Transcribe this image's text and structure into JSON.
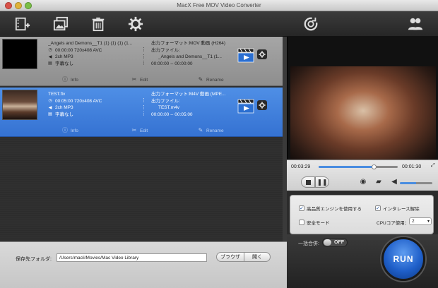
{
  "window": {
    "title": "MacX Free MOV Video Converter"
  },
  "toolbar": {
    "add_video": "add-video-icon",
    "add_photo": "add-photo-icon",
    "delete": "trash-icon",
    "settings": "gear-icon",
    "update": "refresh-icon",
    "users": "users-icon"
  },
  "files": [
    {
      "name": "_Angels and Demons__T1 (1) (1) (1) (1...",
      "duration_res": "00:00:00 720x408 AVC",
      "audio": "2ch MP3",
      "subtitle": "字幕なし",
      "output_format": "出力フォーマット:MOV 動画 (H264)",
      "output_file_label": "出力ファイル:",
      "output_file": "_Angels and Demons__T1 (1...",
      "time_range": "00:00:00 -- 00:00:00",
      "info": "Info",
      "edit": "Edit",
      "rename": "Rename"
    },
    {
      "name": "TEST.flv",
      "duration_res": "00:05:00 720x408 AVC",
      "audio": "2ch MP3",
      "subtitle": "字幕なし",
      "output_format": "出力フォーマット:M4V 動画 (MPE...",
      "output_file_label": "出力ファイル:",
      "output_file": "TEST.m4v",
      "time_range": "00:00:00 -- 00:05:00",
      "info": "Info",
      "edit": "Edit",
      "rename": "Rename"
    }
  ],
  "player": {
    "current_time": "00:03:29",
    "total_time": "00:01:30",
    "progress_fraction": 0.7,
    "volume_fraction": 0.5
  },
  "options": {
    "hq_engine": "高品質エンジンを使用する",
    "deinterlace": "インタレース解除",
    "safe_mode": "安全モード",
    "cpu_label": "CPUコア使用：",
    "cpu_value": "2"
  },
  "footer": {
    "output_folder_label": "保存先フォルダ:",
    "output_path": "/Users/macli/Movies/Mac Video Library",
    "browse": "ブラウザ",
    "open": "開く",
    "merge_label": "一括合併:",
    "merge_state": "OFF",
    "run": "RUN"
  },
  "colors": {
    "selected": "#3a78d8",
    "accent": "#4a8de0"
  }
}
